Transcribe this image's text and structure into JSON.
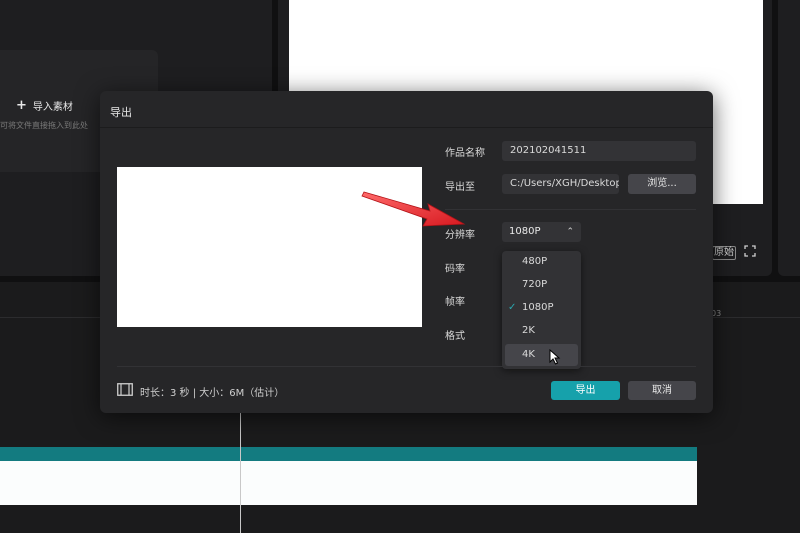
{
  "background": {
    "import_button_label": "导入素材",
    "import_hint": "可将文件直接拖入到此处",
    "fullscreen_label": "原始",
    "ruler_number": "03"
  },
  "dialog": {
    "title": "导出",
    "name_label": "作品名称",
    "name_value": "202102041511",
    "path_label": "导出至",
    "path_value": "C:/Users/XGH/Desktop",
    "browse_label": "浏览...",
    "resolution_label": "分辨率",
    "resolution_value": "1080P",
    "bitrate_label": "码率",
    "framerate_label": "帧率",
    "format_label": "格式",
    "resolution_options": [
      "480P",
      "720P",
      "1080P",
      "2K",
      "4K"
    ],
    "selected_option": "1080P",
    "hovered_option": "4K",
    "info_text": "时长：3 秒 | 大小：6M（估计）",
    "export_label": "导出",
    "cancel_label": "取消"
  },
  "colors": {
    "accent": "#16a1ab",
    "annotation_arrow": "#e0262b"
  },
  "icons": {
    "film": "film-icon",
    "expand": "expand-icon",
    "check": "check-icon",
    "chevron": "chevron-up-icon",
    "cursor": "mouse-cursor-icon",
    "arrow": "annotation-arrow-icon"
  }
}
